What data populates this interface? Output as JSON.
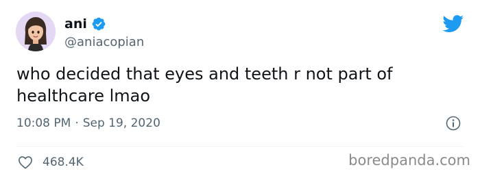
{
  "tweet": {
    "display_name": "ani",
    "handle": "@aniacopian",
    "text": "who decided that eyes and teeth r not part of\nhealthcare lmao",
    "time": "10:08 PM",
    "separator": "·",
    "date": "Sep 19, 2020",
    "like_count": "468.4K"
  },
  "icons": {
    "avatar": "memoji-avatar",
    "verified": "verified-badge-icon",
    "brand": "twitter-bird-icon",
    "info": "info-icon",
    "like": "heart-icon"
  },
  "watermark": "boredpanda.com",
  "colors": {
    "accent": "#1d9bf0",
    "text_primary": "#0f1419",
    "text_secondary": "#536471",
    "avatar_bg": "#e4d8f5"
  }
}
